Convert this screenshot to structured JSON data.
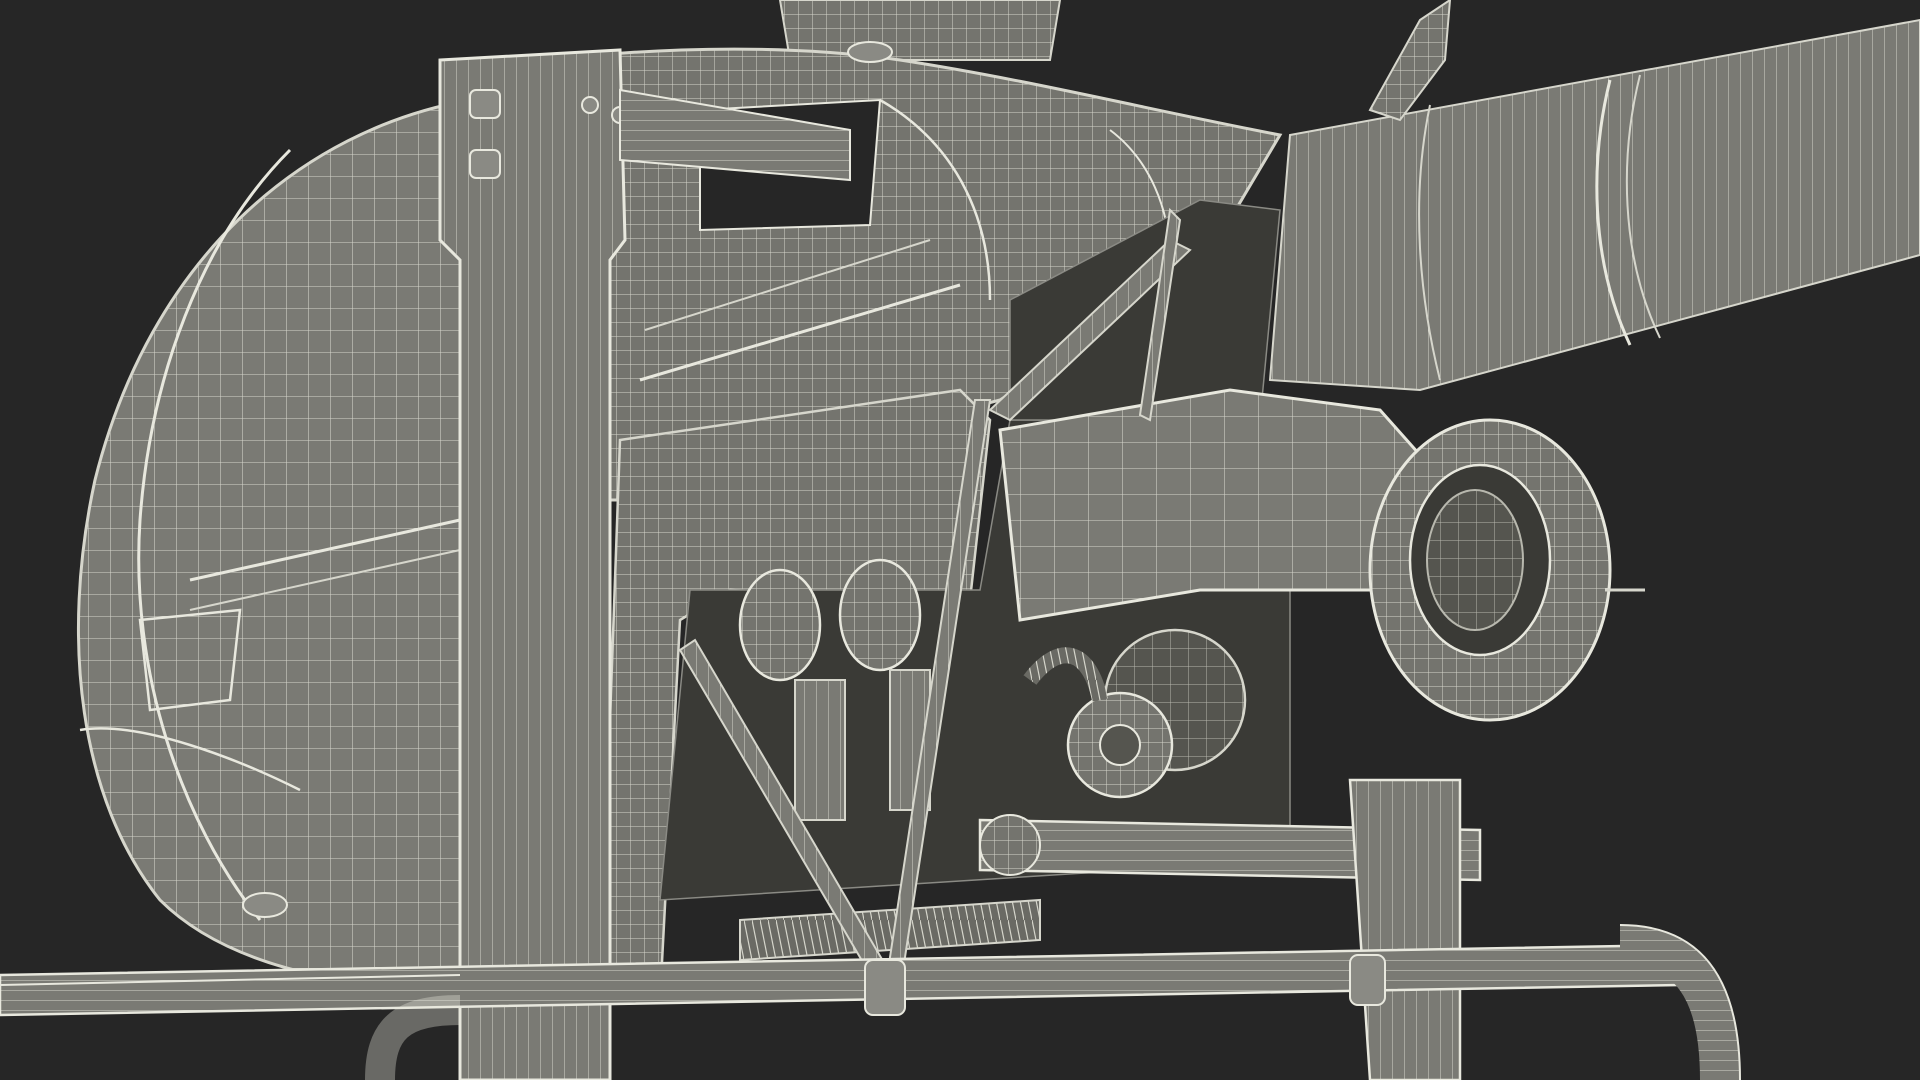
{
  "scene": {
    "subject": "helicopter-wireframe-render",
    "background_color": "#262626",
    "surface_color": "#7a7a74",
    "surface_dark_color": "#5e5e59",
    "wire_color": "#d6d6cc",
    "rivet_color": "#e8e8de"
  }
}
